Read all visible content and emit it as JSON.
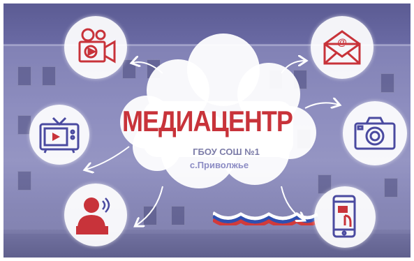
{
  "banner": {
    "title": "МЕДИАЦЕНТР",
    "school": "ГБОУ СОШ №1",
    "village": "с.Приволжье"
  },
  "icons": [
    "video-camera-icon",
    "tv-icon",
    "person-speaking-icon",
    "email-icon",
    "photo-camera-icon",
    "smartphone-icon"
  ],
  "colors": {
    "accent": "#c8333a",
    "overlay": "#7a7ab2",
    "subtitle": "#8c8cc4"
  }
}
